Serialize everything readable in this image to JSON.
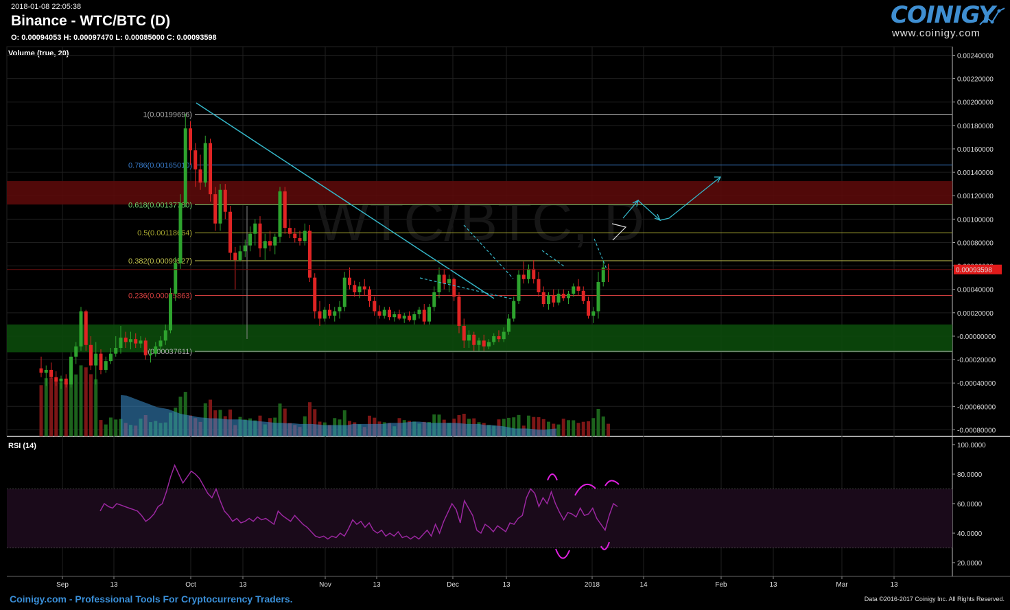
{
  "header": {
    "timestamp": "2018-01-08 22:05:38",
    "title": "Binance - WTC/BTC (D)",
    "ohlc": "O: 0.00094053 H: 0.00097470 L: 0.00085000 C: 0.00093598",
    "watermark": "WTC/BTC, D"
  },
  "logo": {
    "name": "COINIGY",
    "url": "www.coinigy.com"
  },
  "footer": {
    "left": "Coinigy.com - Professional Tools For Cryptocurrency Traders.",
    "right": "Data ©2016-2017 Coinigy Inc. All Rights Reserved."
  },
  "colors": {
    "up": "#2ea32e",
    "down": "#e02424",
    "trend": "#35b6c8",
    "rsi": "#9b27a0",
    "fib_1": "#aaaaaa",
    "fib_786": "#3a7fd0",
    "fib_618": "#6fd36f",
    "fib_5": "#a8a830",
    "fib_382": "#c7c750",
    "fib_236": "#d84040",
    "fib_0": "#aaaaaa"
  },
  "chart_data": [
    {
      "type": "candlestick",
      "panel": "price",
      "pair": "WTC/BTC",
      "exchange": "Binance",
      "interval": "D",
      "x_ticks": [
        "Sep",
        "13",
        "Oct",
        "13",
        "Nov",
        "13",
        "Dec",
        "13",
        "2018",
        "14",
        "Feb",
        "13",
        "Mar",
        "13"
      ],
      "y_ticks": [
        "0.00240000",
        "0.00220000",
        "0.00200000",
        "0.00180000",
        "0.00160000",
        "0.00140000",
        "0.00120000",
        "0.00100000",
        "0.00080000",
        "0.00060000",
        "0.00040000",
        "0.00020000",
        "-0.00000000",
        "-0.00020000",
        "-0.00040000",
        "-0.00060000",
        "-0.00080000"
      ],
      "ylim": [
        -0.0008,
        0.0025
      ],
      "last_price": "0.00093598",
      "fib_levels": [
        {
          "label": "1(0.00199696)",
          "value": 0.00199696
        },
        {
          "label": "0.786(0.00165010)",
          "value": 0.0016501
        },
        {
          "label": "0.618(0.00137780)",
          "value": 0.0013778
        },
        {
          "label": "0.5(0.00118664)",
          "value": 0.00118664
        },
        {
          "label": "0.382(0.00099527)",
          "value": 0.00099527
        },
        {
          "label": "0.236(0.00075863)",
          "value": 0.00075863
        },
        {
          "label": "0(0.00037611)",
          "value": 0.00037611
        }
      ],
      "zones": [
        {
          "color": "red",
          "from": 0.00138,
          "to": 0.00154
        },
        {
          "color": "green",
          "from": 0.00037,
          "to": 0.00056
        }
      ],
      "candles": [
        [
          0.00026,
          0.00034,
          0.0002,
          0.00023
        ],
        [
          0.00023,
          0.00028,
          0.00014,
          0.00025
        ],
        [
          0.00025,
          0.0003,
          0.00019,
          0.0002
        ],
        [
          0.0002,
          0.00024,
          0.00014,
          0.00017
        ],
        [
          0.00017,
          0.00021,
          0.00012,
          0.00019
        ],
        [
          0.00019,
          0.00022,
          0.00013,
          0.00015
        ],
        [
          0.00015,
          0.00037,
          0.00013,
          0.00034
        ],
        [
          0.00034,
          0.00044,
          0.00029,
          0.00041
        ],
        [
          0.00041,
          0.00068,
          0.00038,
          0.00065
        ],
        [
          0.00065,
          0.00066,
          0.00038,
          0.00042
        ],
        [
          0.00042,
          0.00048,
          0.00025,
          0.00028
        ],
        [
          0.00028,
          0.00044,
          0.00015,
          0.00036
        ],
        [
          0.00036,
          0.00039,
          0.00022,
          0.00025
        ],
        [
          0.00025,
          0.00034,
          0.00023,
          0.00031
        ],
        [
          0.00031,
          0.0004,
          0.00029,
          0.00036
        ],
        [
          0.00036,
          0.00048,
          0.00034,
          0.0004
        ],
        [
          0.0004,
          0.00055,
          0.00036,
          0.00047
        ],
        [
          0.00047,
          0.00051,
          0.0004,
          0.00044
        ],
        [
          0.00044,
          0.00051,
          0.00039,
          0.00046
        ],
        [
          0.00046,
          0.0005,
          0.0004,
          0.00043
        ],
        [
          0.00043,
          0.00048,
          0.0004,
          0.00045
        ],
        [
          0.00045,
          0.00047,
          0.00032,
          0.00035
        ],
        [
          0.00035,
          0.00039,
          0.0003,
          0.00036
        ],
        [
          0.00036,
          0.00044,
          0.00034,
          0.00041
        ],
        [
          0.00041,
          0.00048,
          0.00038,
          0.00045
        ],
        [
          0.00045,
          0.00056,
          0.00042,
          0.00052
        ],
        [
          0.00052,
          0.00081,
          0.0005,
          0.00077
        ],
        [
          0.00077,
          0.00102,
          0.00072,
          0.00098
        ],
        [
          0.00098,
          0.00145,
          0.00094,
          0.00139
        ],
        [
          0.00139,
          0.002,
          0.00136,
          0.0019
        ],
        [
          0.0019,
          0.00195,
          0.00165,
          0.00175
        ],
        [
          0.00175,
          0.0018,
          0.0015,
          0.00162
        ],
        [
          0.00162,
          0.00172,
          0.00148,
          0.00153
        ],
        [
          0.00153,
          0.00185,
          0.0015,
          0.0018
        ],
        [
          0.0018,
          0.00183,
          0.0014,
          0.00145
        ],
        [
          0.00145,
          0.0015,
          0.0012,
          0.00125
        ],
        [
          0.00125,
          0.00152,
          0.0012,
          0.00148
        ],
        [
          0.00148,
          0.00152,
          0.00128,
          0.00133
        ],
        [
          0.00133,
          0.00137,
          0.001,
          0.00105
        ],
        [
          0.00105,
          0.00109,
          0.0008,
          0.001
        ],
        [
          0.001,
          0.0011,
          0.00099,
          0.00106
        ],
        [
          0.00106,
          0.00114,
          0.00102,
          0.0011
        ],
        [
          0.0011,
          0.00123,
          0.00106,
          0.00118
        ],
        [
          0.00118,
          0.00128,
          0.0011,
          0.00125
        ],
        [
          0.00125,
          0.0013,
          0.00102,
          0.00108
        ],
        [
          0.00108,
          0.00118,
          0.001,
          0.00113
        ],
        [
          0.00113,
          0.0012,
          0.00106,
          0.0011
        ],
        [
          0.0011,
          0.00118,
          0.00104,
          0.00116
        ],
        [
          0.00116,
          0.0015,
          0.00112,
          0.00147
        ],
        [
          0.00147,
          0.0015,
          0.00118,
          0.00122
        ],
        [
          0.00122,
          0.00128,
          0.00115,
          0.00118
        ],
        [
          0.00118,
          0.00122,
          0.00112,
          0.00115
        ],
        [
          0.00115,
          0.0012,
          0.0011,
          0.00113
        ],
        [
          0.00113,
          0.00125,
          0.0011,
          0.0012
        ],
        [
          0.0012,
          0.00124,
          0.00085,
          0.00088
        ],
        [
          0.00088,
          0.00091,
          0.0006,
          0.00065
        ],
        [
          0.00065,
          0.00072,
          0.00055,
          0.0006
        ],
        [
          0.0006,
          0.00068,
          0.00058,
          0.00066
        ],
        [
          0.00066,
          0.0007,
          0.0006,
          0.00062
        ],
        [
          0.00062,
          0.00068,
          0.00058,
          0.00065
        ],
        [
          0.00065,
          0.00072,
          0.0006,
          0.00068
        ],
        [
          0.00068,
          0.00092,
          0.00065,
          0.00088
        ],
        [
          0.00088,
          0.00095,
          0.0008,
          0.00083
        ],
        [
          0.00083,
          0.00086,
          0.00075,
          0.00078
        ],
        [
          0.00078,
          0.00085,
          0.00074,
          0.00082
        ],
        [
          0.00082,
          0.00087,
          0.00076,
          0.0008
        ],
        [
          0.0008,
          0.00082,
          0.00068,
          0.00072
        ],
        [
          0.00072,
          0.00075,
          0.00062,
          0.00065
        ],
        [
          0.00065,
          0.00069,
          0.0006,
          0.00062
        ],
        [
          0.00062,
          0.00068,
          0.0006,
          0.00066
        ],
        [
          0.00066,
          0.00068,
          0.00059,
          0.00061
        ],
        [
          0.00061,
          0.00065,
          0.00058,
          0.00063
        ],
        [
          0.00063,
          0.00066,
          0.00059,
          0.0006
        ],
        [
          0.0006,
          0.00064,
          0.00057,
          0.00062
        ],
        [
          0.00062,
          0.00065,
          0.00058,
          0.00059
        ],
        [
          0.00059,
          0.00065,
          0.00056,
          0.00063
        ],
        [
          0.00063,
          0.00068,
          0.0006,
          0.00066
        ],
        [
          0.00066,
          0.0007,
          0.00056,
          0.00058
        ],
        [
          0.00058,
          0.0007,
          0.00056,
          0.00068
        ],
        [
          0.00068,
          0.00082,
          0.00065,
          0.00078
        ],
        [
          0.00078,
          0.00095,
          0.00074,
          0.0009
        ],
        [
          0.0009,
          0.00094,
          0.0008,
          0.00084
        ],
        [
          0.00084,
          0.0009,
          0.00078,
          0.00087
        ],
        [
          0.00087,
          0.00088,
          0.00072,
          0.00075
        ],
        [
          0.00075,
          0.00078,
          0.0005,
          0.00055
        ],
        [
          0.00055,
          0.0006,
          0.0004,
          0.00045
        ],
        [
          0.00045,
          0.00052,
          0.0004,
          0.00049
        ],
        [
          0.00049,
          0.00051,
          0.00038,
          0.00042
        ],
        [
          0.00042,
          0.00047,
          0.00038,
          0.00045
        ],
        [
          0.00045,
          0.00049,
          0.00038,
          0.00041
        ],
        [
          0.00041,
          0.00046,
          0.00039,
          0.00044
        ],
        [
          0.00044,
          0.0005,
          0.00042,
          0.00048
        ],
        [
          0.00048,
          0.00052,
          0.00044,
          0.00046
        ],
        [
          0.00046,
          0.00054,
          0.00044,
          0.00051
        ],
        [
          0.00051,
          0.00063,
          0.00049,
          0.0006
        ],
        [
          0.0006,
          0.00075,
          0.00058,
          0.00072
        ],
        [
          0.00072,
          0.00093,
          0.0007,
          0.0009
        ],
        [
          0.0009,
          0.00099,
          0.00084,
          0.00087
        ],
        [
          0.00087,
          0.00097,
          0.00084,
          0.00094
        ],
        [
          0.00094,
          0.001,
          0.00084,
          0.00087
        ],
        [
          0.00087,
          0.00092,
          0.00075,
          0.00078
        ],
        [
          0.00078,
          0.00082,
          0.00068,
          0.0007
        ],
        [
          0.0007,
          0.00078,
          0.00066,
          0.00076
        ],
        [
          0.00076,
          0.0008,
          0.00068,
          0.00071
        ],
        [
          0.00071,
          0.0008,
          0.00069,
          0.00077
        ],
        [
          0.00077,
          0.0008,
          0.00072,
          0.00074
        ],
        [
          0.00074,
          0.00079,
          0.0007,
          0.00077
        ],
        [
          0.00077,
          0.00084,
          0.00075,
          0.00082
        ],
        [
          0.00082,
          0.00087,
          0.00076,
          0.00079
        ],
        [
          0.00079,
          0.00082,
          0.0007,
          0.00072
        ],
        [
          0.00072,
          0.00075,
          0.0006,
          0.00062
        ],
        [
          0.00062,
          0.00068,
          0.00057,
          0.00065
        ],
        [
          0.00065,
          0.00092,
          0.0006,
          0.00085
        ],
        [
          0.00085,
          0.001,
          0.00082,
          0.00095
        ],
        [
          0.00094053,
          0.0009747,
          0.00085,
          0.00093598
        ]
      ],
      "volume_ma": [
        0.000365,
        0.00036,
        0.00034,
        0.00032,
        0.0003,
        0.00028,
        0.00026,
        0.00025,
        0.00024,
        0.00022,
        0.0002,
        0.00019,
        0.00018,
        0.00017,
        0.000165,
        0.00016,
        0.00016,
        0.000155,
        0.00015,
        0.00015,
        0.00015,
        0.000145,
        0.00014,
        0.000135,
        0.00013,
        0.000125,
        0.00012,
        0.00012,
        0.000115,
        0.000115,
        0.00011,
        0.00011,
        0.00011,
        0.000105,
        0.0001,
        0.0001,
        0.0001,
        0.0001,
        0.0001,
        0.00011,
        0.00011,
        0.00011,
        0.00011,
        0.00011,
        0.00011,
        0.00012,
        0.00012,
        0.00012,
        0.000125,
        0.00013,
        0.00013,
        0.000125,
        0.00012,
        0.00012,
        0.00012,
        0.00012,
        0.00012,
        0.000115,
        0.00011,
        0.00011,
        0.00011,
        0.0001,
        0.0001,
        9.5e-05,
        9e-05,
        8e-05,
        7e-05,
        7e-05,
        7e-05,
        6.5e-05,
        6e-05,
        6e-05,
        6.5e-05,
        7e-05
      ]
    },
    {
      "type": "line",
      "panel": "rsi",
      "name": "RSI (14)",
      "y_ticks": [
        "100.0000",
        "80.0000",
        "60.0000",
        "40.0000",
        "20.0000"
      ],
      "ylim": [
        10,
        100
      ],
      "bands": [
        30,
        70
      ],
      "values": [
        55,
        60,
        58,
        57,
        60,
        59,
        58,
        57,
        56,
        55,
        52,
        48,
        50,
        53,
        58,
        60,
        68,
        78,
        86,
        80,
        74,
        78,
        82,
        80,
        77,
        72,
        67,
        64,
        70,
        62,
        55,
        52,
        48,
        50,
        47,
        48,
        50,
        48,
        51,
        49,
        50,
        48,
        46,
        55,
        52,
        50,
        48,
        52,
        49,
        46,
        44,
        41,
        38,
        37,
        38,
        36,
        38,
        37,
        40,
        38,
        43,
        49,
        46,
        48,
        44,
        47,
        42,
        40,
        42,
        38,
        40,
        38,
        41,
        37,
        38,
        36,
        38,
        36,
        39,
        42,
        38,
        46,
        40,
        48,
        54,
        60,
        56,
        47,
        62,
        57,
        52,
        42,
        40,
        46,
        44,
        41,
        45,
        43,
        41,
        47,
        46,
        50,
        52,
        64,
        70,
        67,
        58,
        64,
        60,
        68,
        60,
        54,
        49,
        54,
        53,
        51,
        57,
        52,
        53,
        57,
        50,
        46,
        42,
        52,
        60,
        58
      ],
      "annotations": [
        {
          "x": 106,
          "y": 76
        },
        {
          "x": 114,
          "y": 72
        },
        {
          "x": 122,
          "y": 74
        },
        {
          "x": 108,
          "y": 26
        },
        {
          "x": 119,
          "y": 31
        }
      ]
    }
  ]
}
